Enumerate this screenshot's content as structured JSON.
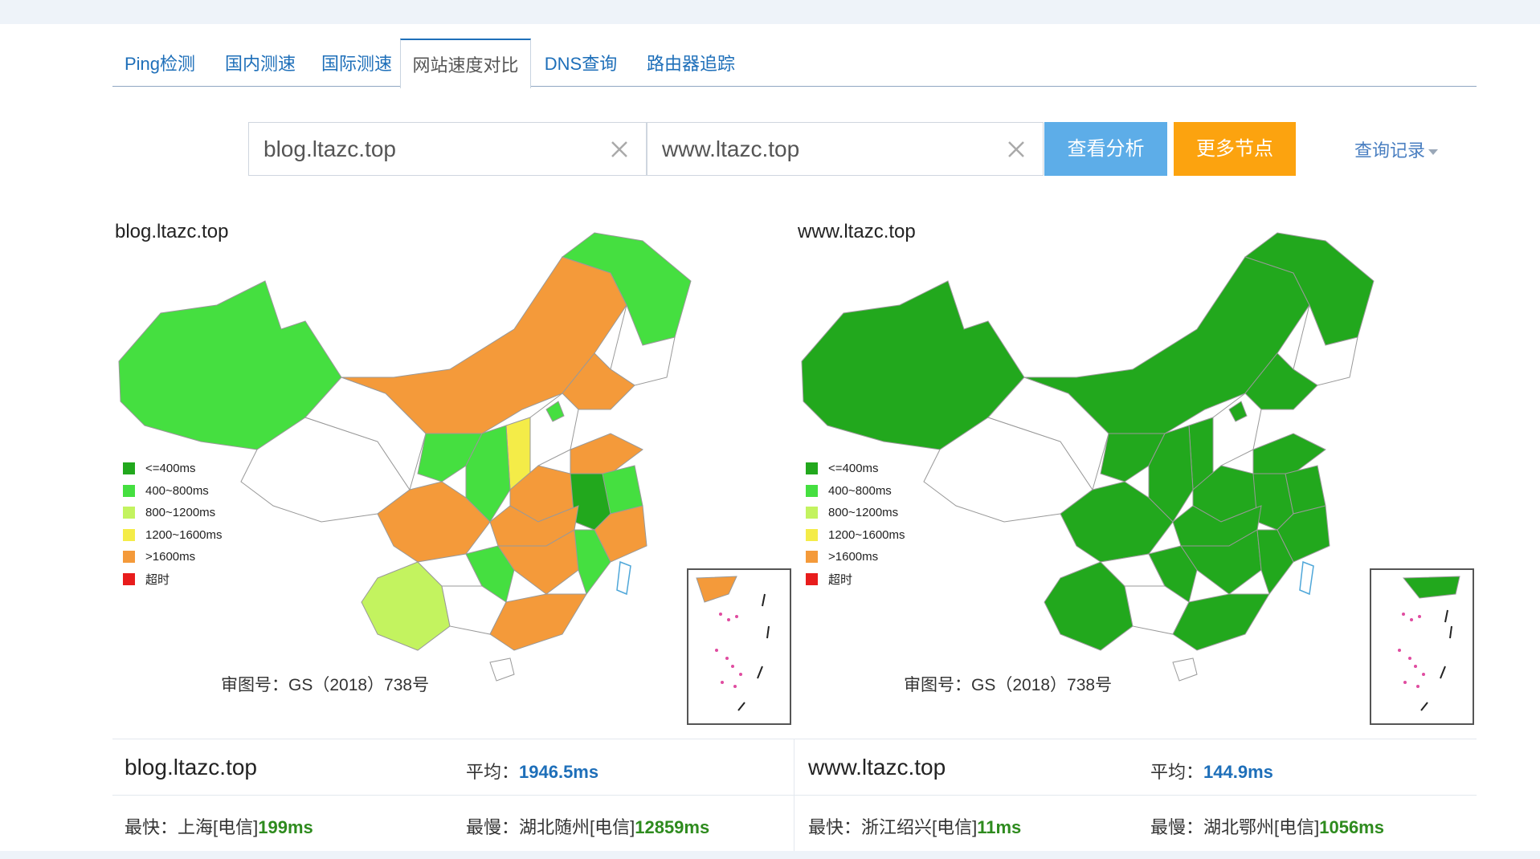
{
  "tabs": [
    {
      "label": "Ping检测",
      "active": false
    },
    {
      "label": "国内测速",
      "active": false
    },
    {
      "label": "国际测速",
      "active": false
    },
    {
      "label": "网站速度对比",
      "active": true
    },
    {
      "label": "DNS查询",
      "active": false
    },
    {
      "label": "路由器追踪",
      "active": false
    }
  ],
  "search": {
    "field1_value": "blog.ltazc.top",
    "field2_value": "www.ltazc.top",
    "analyze_label": "查看分析",
    "more_nodes_label": "更多节点",
    "history_label": "查询记录"
  },
  "legend": [
    {
      "label": "<=400ms",
      "color": "#22a81d"
    },
    {
      "label": "400~800ms",
      "color": "#45df40"
    },
    {
      "label": "800~1200ms",
      "color": "#c3f35f"
    },
    {
      "label": "1200~1600ms",
      "color": "#f4ec48"
    },
    {
      "label": ">1600ms",
      "color": "#f49a3a"
    },
    {
      "label": "超时",
      "color": "#e81c1c"
    }
  ],
  "maps": [
    {
      "title": "blog.ltazc.top",
      "gs": "审图号：GS（2018）738号"
    },
    {
      "title": "www.ltazc.top",
      "gs": "审图号：GS（2018）738号"
    }
  ],
  "results": [
    {
      "domain": "blog.ltazc.top",
      "avg_label": "平均：",
      "avg_value": "1946.5ms",
      "fast_label": "最快：上海[电信]",
      "fast_value": "199ms",
      "slow_label": "最慢：湖北随州[电信]",
      "slow_value": "12859ms"
    },
    {
      "domain": "www.ltazc.top",
      "avg_label": "平均：",
      "avg_value": "144.9ms",
      "fast_label": "最快：浙江绍兴[电信]",
      "fast_value": "11ms",
      "slow_label": "最慢：湖北鄂州[电信]",
      "slow_value": "1056ms"
    }
  ],
  "colors": {
    "accent": "#1e6fb9",
    "analyze_button": "#5dade8",
    "more_button": "#fca30f"
  }
}
